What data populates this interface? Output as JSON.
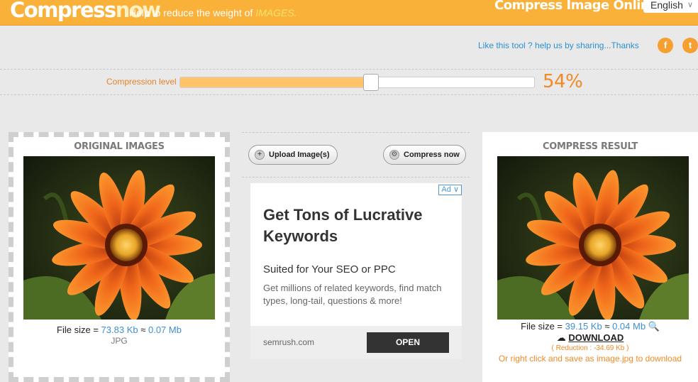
{
  "header": {
    "logo_part1": "Compress",
    "logo_part2": "now",
    "tagline": "Help to reduce the weight of",
    "tagline_highlight": "IMAGES.",
    "title_right": "Compress Image Online",
    "language": "English"
  },
  "share": {
    "text": "Like this tool ? help us by sharing...Thanks",
    "facebook_glyph": "f",
    "twitter_glyph": "t"
  },
  "compression": {
    "label": "Compression level",
    "percent_text": "54%",
    "level": 0.54
  },
  "original": {
    "title": "ORIGINAL IMAGES",
    "filesize_label": "File size =",
    "filesize_kb": "73.83 Kb",
    "approx": "≈",
    "filesize_mb": "0.07 Mb",
    "format": "JPG"
  },
  "actions": {
    "upload_label": "Upload Image(s)",
    "compress_label": "Compress now"
  },
  "ad": {
    "badge": "Ad",
    "headline": "Get Tons of Lucrative Keywords",
    "subheadline": "Suited for Your SEO or PPC",
    "body": "Get millions of related keywords, find match types, long-tail, questions & more!",
    "domain": "semrush.com",
    "cta": "OPEN"
  },
  "result": {
    "title": "COMPRESS RESULT",
    "filesize_label": "File size =",
    "filesize_kb": "39.15 Kb",
    "approx": "≈",
    "filesize_mb": "0.04 Mb",
    "download_label": "DOWNLOAD",
    "reduction": "( Reduction : -34.69 Kb )",
    "save_hint": "Or right click and save as image.jpg to download"
  },
  "colors": {
    "accent": "#f9b13a",
    "link": "#3f8fd0",
    "orange_text": "#f08a26"
  }
}
